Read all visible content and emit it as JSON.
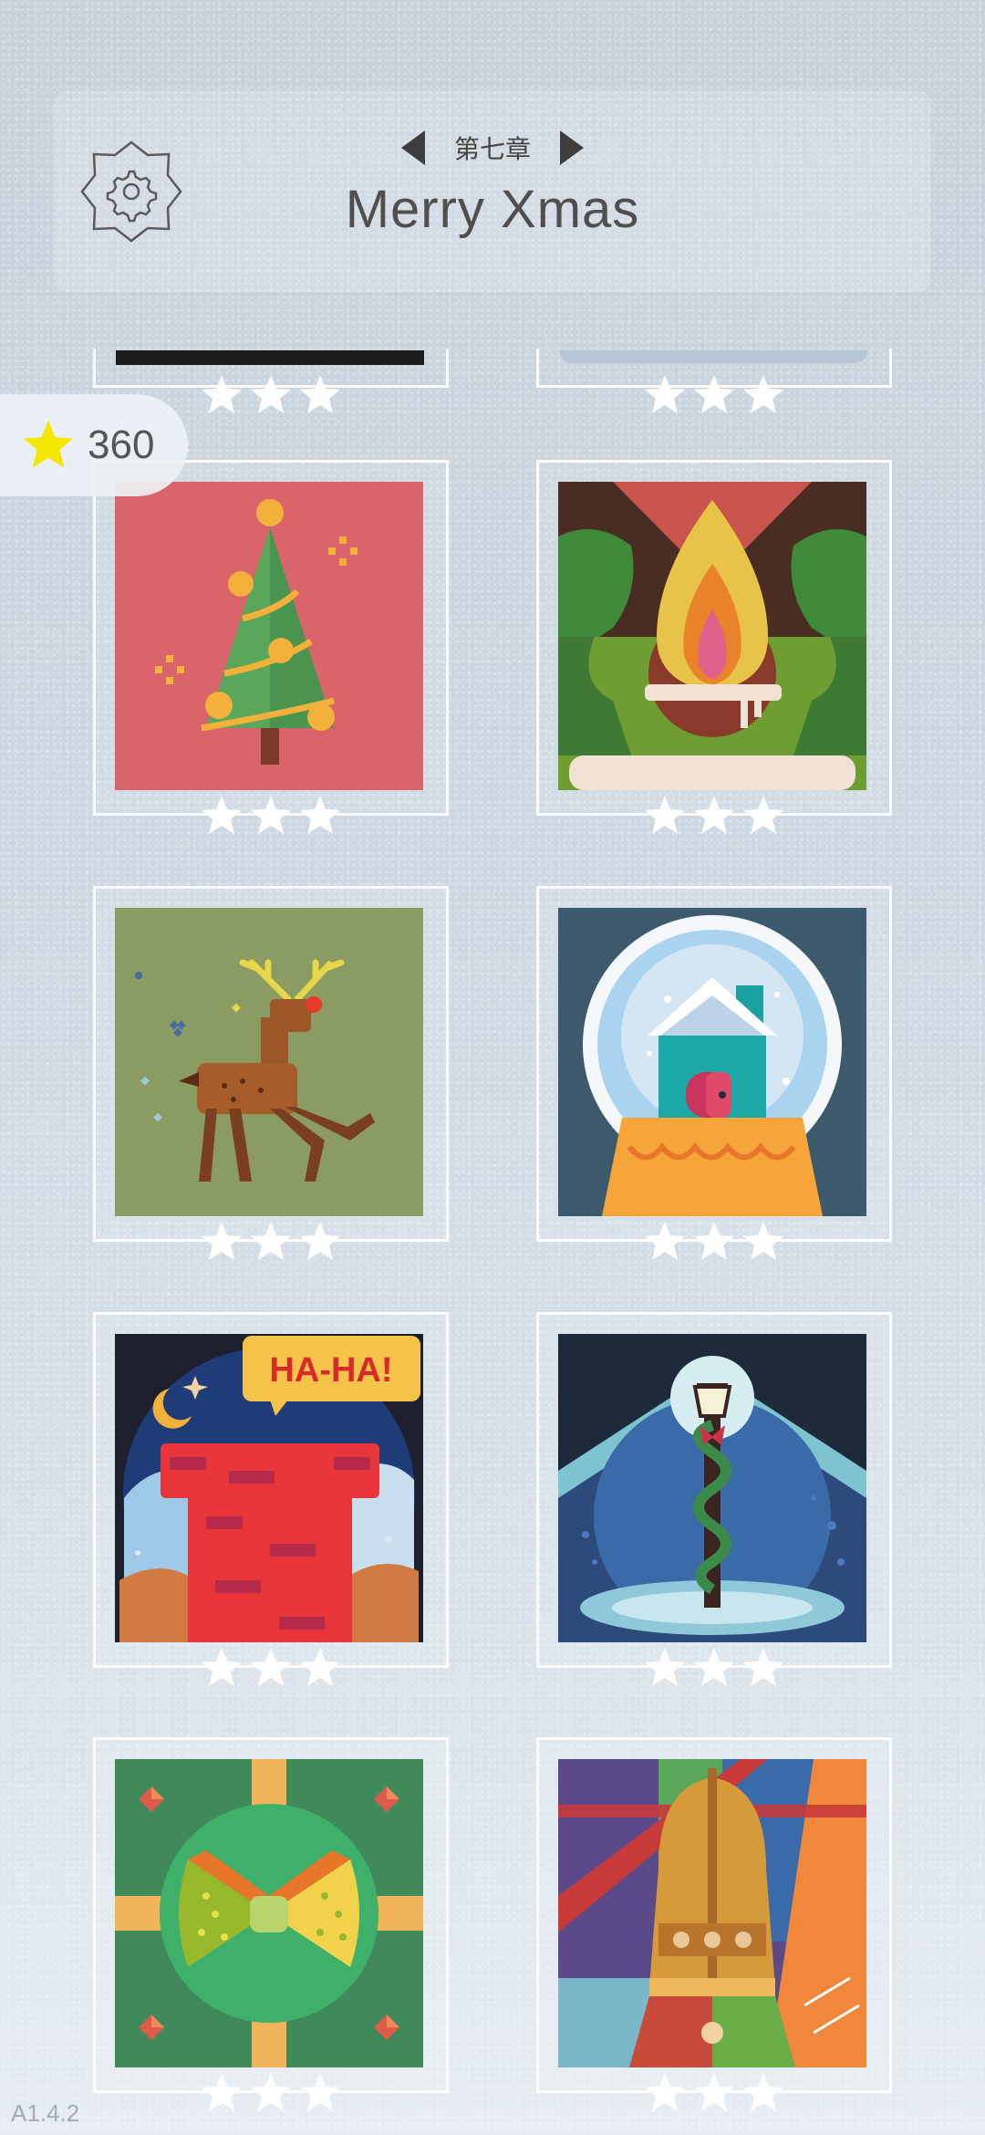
{
  "header": {
    "chapter_label": "第七章",
    "title": "Merry Xmas"
  },
  "stars_total": "360",
  "version": "A1.4.2",
  "levels": [
    {
      "name": "christmas-tree",
      "stars": 3
    },
    {
      "name": "fireplace",
      "stars": 3
    },
    {
      "name": "reindeer",
      "stars": 3
    },
    {
      "name": "snow-globe",
      "stars": 3
    },
    {
      "name": "chimney",
      "stars": 3,
      "speech": "HA-HA!"
    },
    {
      "name": "street-lamp",
      "stars": 3
    },
    {
      "name": "gift-bow",
      "stars": 3
    },
    {
      "name": "bell",
      "stars": 3
    }
  ],
  "colors": {
    "star_earned": "#ffffff",
    "badge_star": "#f5e600"
  },
  "icons": [
    "gear-icon",
    "arrow-left-icon",
    "arrow-right-icon",
    "star-icon"
  ]
}
